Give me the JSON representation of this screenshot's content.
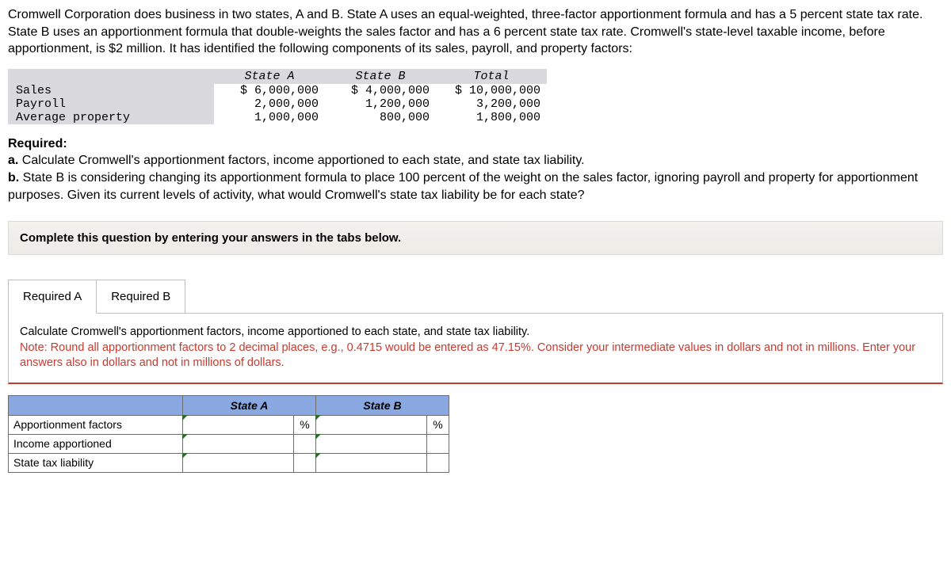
{
  "problem": {
    "intro": "Cromwell Corporation does business in two states, A and B. State A uses an equal-weighted, three-factor apportionment formula and has a 5 percent state tax rate. State B uses an apportionment formula that double-weights the sales factor and has a 6 percent state tax rate. Cromwell's state-level taxable income, before apportionment, is $2 million. It has identified the following components of its sales, payroll, and property factors:"
  },
  "dataTable": {
    "headers": {
      "c0": "",
      "c1": "State A",
      "c2": "State B",
      "c3": "Total"
    },
    "rows": [
      {
        "label": "Sales",
        "a": "$ 6,000,000",
        "b": "$ 4,000,000",
        "t": "$ 10,000,000"
      },
      {
        "label": "Payroll",
        "a": "  2,000,000",
        "b": "  1,200,000",
        "t": "   3,200,000"
      },
      {
        "label": "Average property",
        "a": "  1,000,000",
        "b": "    800,000",
        "t": "   1,800,000"
      }
    ]
  },
  "required": {
    "heading": "Required:",
    "a_label": "a.",
    "a_text": " Calculate Cromwell's apportionment factors, income apportioned to each state, and state tax liability.",
    "b_label": "b.",
    "b_text": " State B is considering changing its apportionment formula to place 100 percent of the weight on the sales factor, ignoring payroll and property for apportionment purposes. Given its current levels of activity, what would Cromwell's state tax liability be for each state?"
  },
  "instruction": "Complete this question by entering your answers in the tabs below.",
  "tabs": {
    "a": "Required A",
    "b": "Required B"
  },
  "panel": {
    "line1": "Calculate Cromwell's apportionment factors, income apportioned to each state, and state tax liability.",
    "note": "Note: Round all apportionment factors to 2 decimal places, e.g., 0.4715 would be entered as 47.15%. Consider your intermediate values in dollars and not in millions. Enter your answers also in dollars and not in millions of dollars."
  },
  "answer": {
    "colA": "State A",
    "colB": "State B",
    "rows": [
      "Apportionment factors",
      "Income apportioned",
      "State tax liability"
    ],
    "pct": "%"
  }
}
